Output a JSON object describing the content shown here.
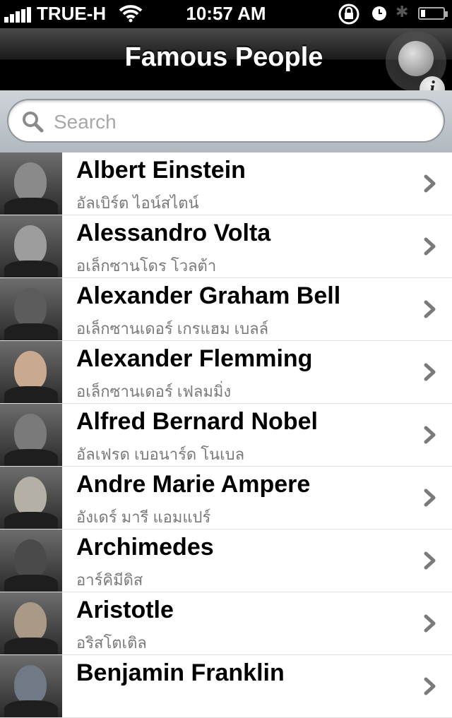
{
  "status_bar": {
    "carrier": "TRUE-H",
    "time": "10:57 AM",
    "icons": [
      "signal-icon",
      "wifi-icon",
      "rotation-lock-icon",
      "alarm-clock-icon",
      "bluetooth-icon",
      "battery-icon"
    ]
  },
  "nav": {
    "title": "Famous People",
    "info_label": "i"
  },
  "search": {
    "placeholder": "Search",
    "value": ""
  },
  "people": [
    {
      "name": "Albert Einstein",
      "thai": "อัลเบิร์ต ไอน์สไตน์",
      "tone": "#8a8a8a"
    },
    {
      "name": "Alessandro Volta",
      "thai": "อเล็กซานโดร โวลต้า",
      "tone": "#9d9d9d"
    },
    {
      "name": "Alexander Graham Bell",
      "thai": "อเล็กซานเดอร์ เกรแฮม เบลล์",
      "tone": "#5c5c5c"
    },
    {
      "name": "Alexander Flemming",
      "thai": "อเล็กซานเดอร์ เฟลมมิ่ง",
      "tone": "#c9a98f"
    },
    {
      "name": "Alfred Bernard Nobel",
      "thai": "อัลเฟรด เบอนาร์ด โนเบล",
      "tone": "#7a7a7a"
    },
    {
      "name": "Andre Marie Ampere",
      "thai": "อังเดร์ มารี แอมแปร์",
      "tone": "#b5b0a6"
    },
    {
      "name": "Archimedes",
      "thai": "อาร์คิมีดิส",
      "tone": "#4a4a4a"
    },
    {
      "name": "Aristotle",
      "thai": "อริสโตเติล",
      "tone": "#a89a86"
    },
    {
      "name": "Benjamin Franklin",
      "thai": "",
      "tone": "#707a86"
    }
  ],
  "colors": {
    "nav_bg": "#000000",
    "search_bg": "#b1b8bf",
    "subtitle": "#7a7a7a",
    "chevron": "#7a7a7a"
  }
}
